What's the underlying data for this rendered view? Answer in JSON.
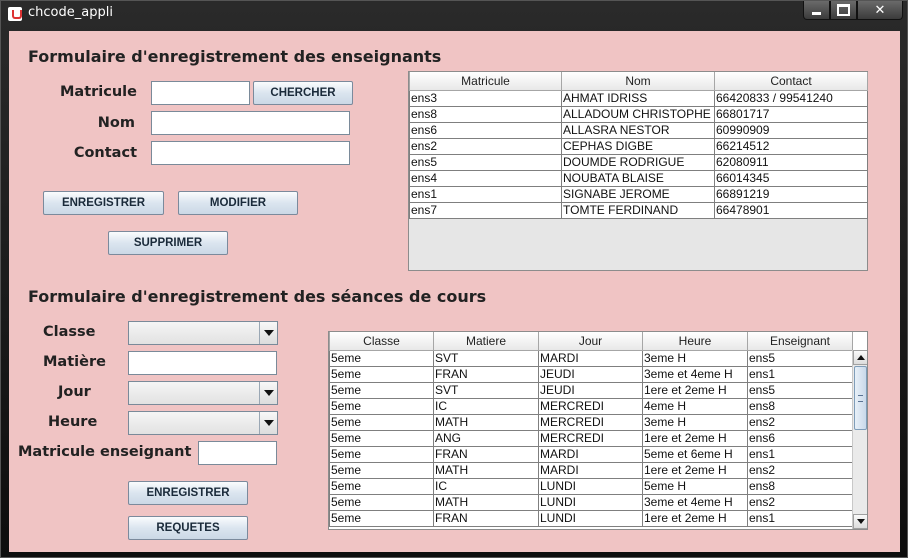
{
  "window": {
    "title": "chcode_appli"
  },
  "enseignants": {
    "heading": "Formulaire d'enregistrement des enseignants",
    "matricule_label": "Matricule",
    "nom_label": "Nom",
    "contact_label": "Contact",
    "matricule_value": "",
    "nom_value": "",
    "contact_value": "",
    "btn_chercher": "CHERCHER",
    "btn_enregistrer": "ENREGISTRER",
    "btn_modifier": "MODIFIER",
    "btn_supprimer": "SUPPRIMER",
    "table": {
      "headers": [
        "Matricule",
        "Nom",
        "Contact"
      ],
      "rows": [
        [
          "ens3",
          "AHMAT IDRISS",
          "66420833 / 99541240"
        ],
        [
          "ens8",
          "ALLADOUM CHRISTOPHE",
          "66801717"
        ],
        [
          "ens6",
          "ALLASRA NESTOR",
          "60990909"
        ],
        [
          "ens2",
          "CEPHAS DIGBE",
          "66214512"
        ],
        [
          "ens5",
          "DOUMDE RODRIGUE",
          "62080911"
        ],
        [
          "ens4",
          "NOUBATA BLAISE",
          "66014345"
        ],
        [
          "ens1",
          "SIGNABE JEROME",
          "66891219"
        ],
        [
          "ens7",
          "TOMTE FERDINAND",
          "66478901"
        ]
      ]
    }
  },
  "seances": {
    "heading": "Formulaire d'enregistrement des séances de cours",
    "classe_label": "Classe",
    "matiere_label": "Matière",
    "jour_label": "Jour",
    "heure_label": "Heure",
    "matricule_ens_label": "Matricule enseignant",
    "classe_value": "",
    "matiere_value": "",
    "jour_value": "",
    "heure_value": "",
    "matricule_ens_value": "",
    "btn_enregistrer": "ENREGISTRER",
    "btn_requetes": "REQUETES",
    "table": {
      "headers": [
        "Classe",
        "Matiere",
        "Jour",
        "Heure",
        "Enseignant"
      ],
      "rows": [
        [
          "5eme",
          "SVT",
          "MARDI",
          "3eme H",
          "ens5"
        ],
        [
          "5eme",
          "FRAN",
          "JEUDI",
          "3eme  et 4eme H",
          "ens1"
        ],
        [
          "5eme",
          "SVT",
          "JEUDI",
          "1ere et 2eme H",
          "ens5"
        ],
        [
          "5eme",
          "IC",
          "MERCREDI",
          "4eme H",
          "ens8"
        ],
        [
          "5eme",
          "MATH",
          "MERCREDI",
          "3eme H",
          "ens2"
        ],
        [
          "5eme",
          "ANG",
          "MERCREDI",
          "1ere et 2eme H",
          "ens6"
        ],
        [
          "5eme",
          "FRAN",
          "MARDI",
          "5eme et 6eme H",
          "ens1"
        ],
        [
          "5eme",
          "MATH",
          "MARDI",
          "1ere et 2eme H",
          "ens2"
        ],
        [
          "5eme",
          "IC",
          "LUNDI",
          "5eme H",
          "ens8"
        ],
        [
          "5eme",
          "MATH",
          "LUNDI",
          "3eme  et 4eme H",
          "ens2"
        ],
        [
          "5eme",
          "FRAN",
          "LUNDI",
          "1ere et 2eme H",
          "ens1"
        ]
      ]
    }
  }
}
